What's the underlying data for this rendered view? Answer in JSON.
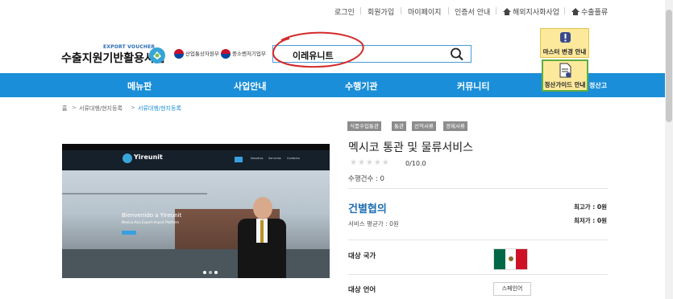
{
  "utility_bar": {
    "items": [
      "로그인",
      "회원가입",
      "마이페이지",
      "인증서 안내",
      "해외지사화사업",
      "수출플류"
    ]
  },
  "header": {
    "logo_sub": "EXPORT VOUCHER",
    "logo_main": "수출지원기반활용사업",
    "gov1": "산업통상자원부",
    "gov2": "중소벤처기업부"
  },
  "search": {
    "value": "이레유니트"
  },
  "floating": {
    "master_guide": "마스터 변경 안내",
    "settle_guide": "정산가이드 안내"
  },
  "nav": {
    "items": [
      "메뉴판",
      "사업안내",
      "수행기관",
      "커뮤니티",
      "정산고"
    ]
  },
  "breadcrumb": [
    "홈",
    "서류대행/현지등록",
    "서류대행/현지등록"
  ],
  "product_image": {
    "site_name": "Yireunit",
    "hero_title": "Bienvenido a Yireunit",
    "hero_sub": "Mexico-Asia Export-Import Platform",
    "nav_links": [
      "Nosotros",
      "Servicios",
      "Contacto"
    ]
  },
  "product": {
    "tags": [
      "식품수입통관",
      "통관",
      "선적서류",
      "경제서류"
    ],
    "title": "멕시코 통관 및 물류서비스",
    "rating_stars": "★★★★★",
    "score": "0/10.0",
    "count": "수행건수 : 0",
    "price": "건별협의",
    "avg_price": "서비스 평균가 : 0원",
    "max_price": "최고가 : 0원",
    "min_price": "최저가 : 0원",
    "country_label": "대상 국가",
    "language_label": "대상 언어",
    "language_button": "스페인어"
  },
  "colors": {
    "nav_bg": "#1a8ed8",
    "price_blue": "#1f6fb2",
    "tag_gray": "#8c8c8c",
    "float_yellow": "#fde99c",
    "flag_green": "#006847",
    "flag_red": "#ce1126"
  }
}
